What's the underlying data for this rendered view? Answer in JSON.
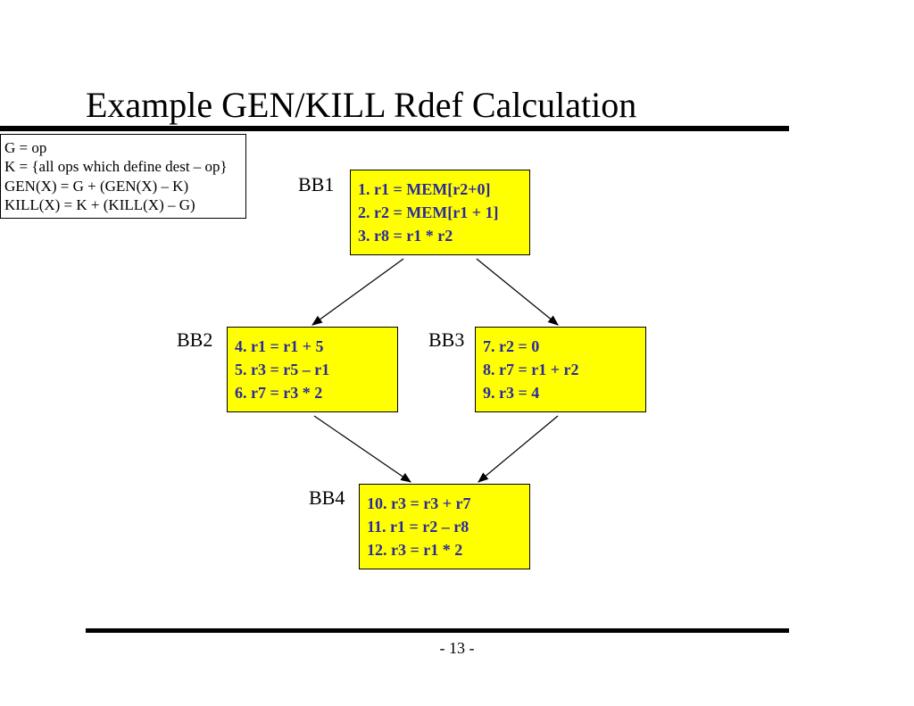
{
  "title": "Example GEN/KILL Rdef Calculation",
  "page_number": "- 13 -",
  "definitions": {
    "line1": "G = op",
    "line2": "K = {all ops which define dest – op}",
    "line3": "GEN(X) = G + (GEN(X) – K)",
    "line4": "KILL(X) = K + (KILL(X) – G)"
  },
  "labels": {
    "bb1": "BB1",
    "bb2": "BB2",
    "bb3": "BB3",
    "bb4": "BB4"
  },
  "blocks": {
    "bb1": {
      "l1": "1. r1 = MEM[r2+0]",
      "l2": "2. r2 = MEM[r1 + 1]",
      "l3": "3. r8 = r1 * r2"
    },
    "bb2": {
      "l1": "4. r1 = r1 + 5",
      "l2": "5. r3 = r5 – r1",
      "l3": "6. r7 = r3 * 2"
    },
    "bb3": {
      "l1": "7. r2 = 0",
      "l2": "8. r7 = r1 + r2",
      "l3": "9. r3 = 4"
    },
    "bb4": {
      "l1": "10. r3 = r3 + r7",
      "l2": "11. r1 = r2 – r8",
      "l3": "12. r3 = r1 * 2"
    }
  }
}
